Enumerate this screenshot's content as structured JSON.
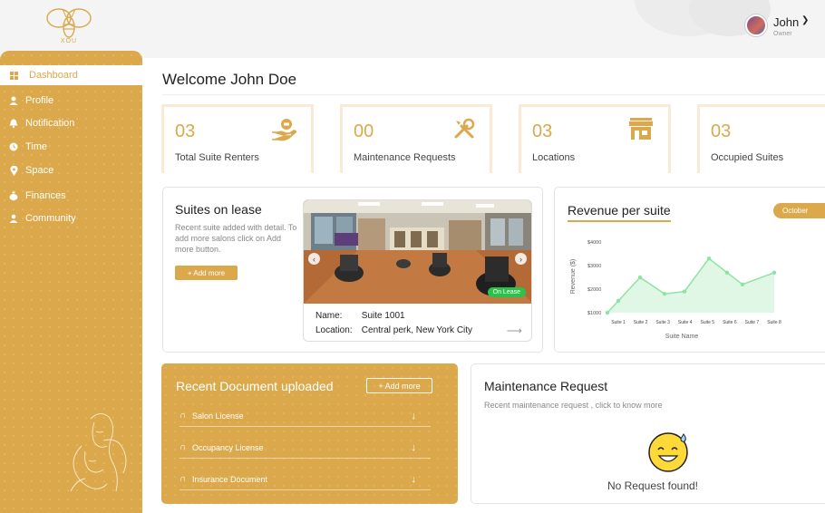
{
  "brand": {
    "logo_text": "XOU"
  },
  "user": {
    "name": "John",
    "role": "Owner",
    "chevron": "chevron-down-icon"
  },
  "sidebar": {
    "items": [
      {
        "label": "Dashboard",
        "icon": "dashboard-icon",
        "active": true
      },
      {
        "label": "Profile",
        "icon": "user-icon"
      },
      {
        "label": "Notification",
        "icon": "bell-icon"
      },
      {
        "label": "Time",
        "icon": "clock-icon"
      },
      {
        "label": "Space",
        "icon": "location-pin-icon"
      },
      {
        "label": "Finances",
        "icon": "money-bag-icon"
      },
      {
        "label": "Community",
        "icon": "community-icon"
      }
    ]
  },
  "welcome": {
    "title": "Welcome John Doe"
  },
  "stats": [
    {
      "value": "03",
      "label": "Total Suite Renters",
      "icon": "hand-coin-icon"
    },
    {
      "value": "00",
      "label": "Maintenance Requests",
      "icon": "tools-icon"
    },
    {
      "value": "03",
      "label": "Locations",
      "icon": "store-icon"
    },
    {
      "value": "03",
      "label": "Occupied Suites",
      "icon": "building-icon"
    }
  ],
  "lease": {
    "title": "Suites on lease",
    "description": "Recent suite added with detail. To add more salons click on Add more button.",
    "add_button": "+ Add more",
    "badge": "On Lease",
    "suite_key": "Name:",
    "suite_value": "Suite 1001",
    "location_key": "Location:",
    "location_value": "Central perk, New York City"
  },
  "revenue": {
    "title": "Revenue per suite",
    "month": "October",
    "colors": {
      "line": "#8fe3a2",
      "fill": "#dff7e4"
    }
  },
  "chart_data": {
    "type": "area",
    "categories": [
      "Suite 1",
      "Suite 2",
      "Suite 3",
      "Suite 4",
      "Suite 5",
      "Suite 6",
      "Suite 7",
      "Suite 8"
    ],
    "values": [
      1100,
      2500,
      1800,
      1800,
      3300,
      2600,
      2150,
      2700
    ],
    "extra_points": [
      {
        "x": "start",
        "value": 1000
      },
      {
        "x": "between 1-2",
        "value": 1700
      },
      {
        "x": "between 3-4",
        "value": 1600
      }
    ],
    "yticks": [
      "$4000",
      "$3000",
      "$2000",
      "$1000"
    ],
    "ylim": [
      1000,
      4000
    ],
    "xlabel": "Suite Name",
    "ylabel": "Revenue ($)",
    "grid": false
  },
  "documents": {
    "title": "Recent Document uploaded",
    "add_button": "+ Add more",
    "items": [
      {
        "label": "Salon License"
      },
      {
        "label": "Occupancy License"
      },
      {
        "label": "Insurance Document"
      }
    ]
  },
  "maintenance": {
    "title": "Maintenance Request",
    "subtitle": "Recent maintenance request , click to know more",
    "empty": "No Request found!"
  }
}
